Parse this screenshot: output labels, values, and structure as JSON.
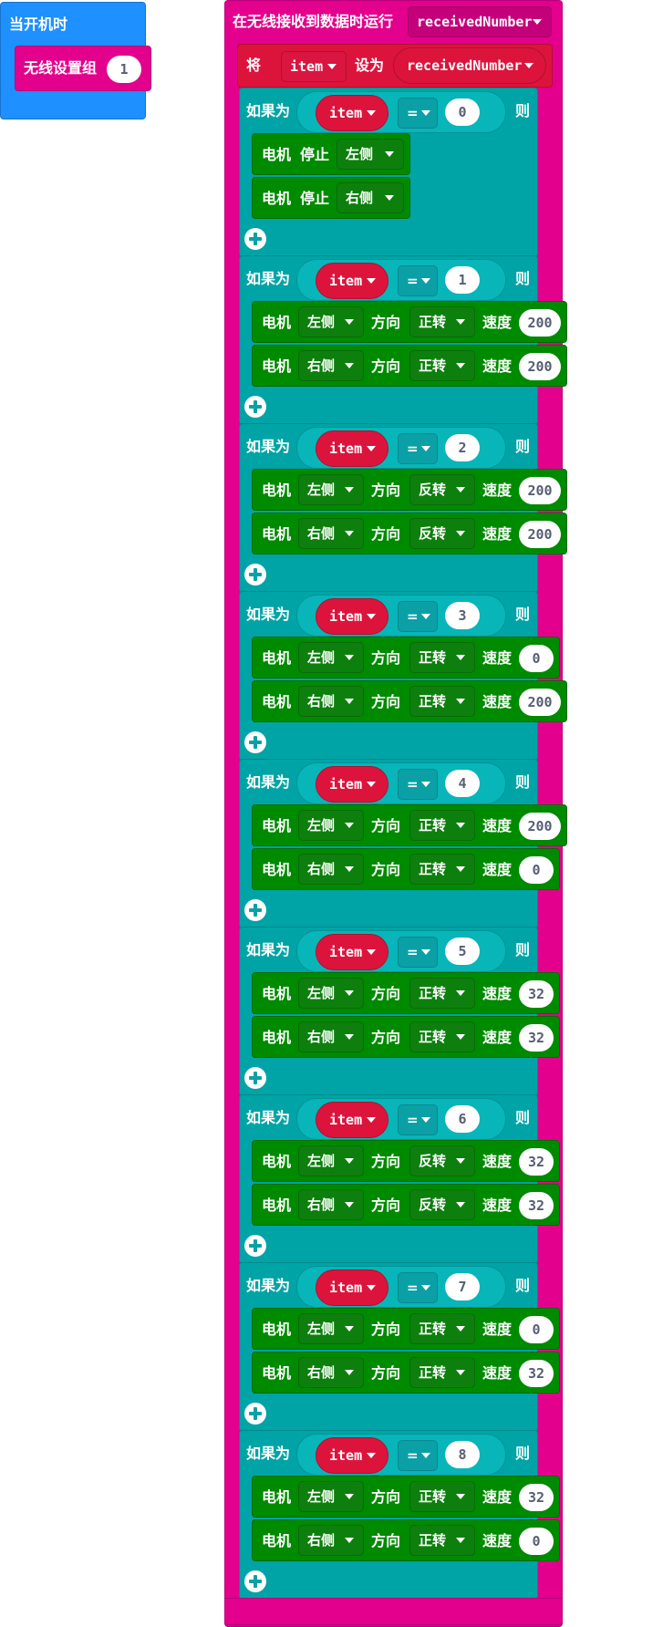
{
  "on_start": {
    "label": "当开机时",
    "radio_set_group": {
      "label": "无线设置组",
      "value": "1"
    }
  },
  "on_received": {
    "label": "在无线接收到数据时运行",
    "param": "receivedNumber",
    "set_block": {
      "label_set": "将",
      "var": "item",
      "label_to": "设为",
      "value": "receivedNumber"
    }
  },
  "if_labels": {
    "if": "如果为",
    "then": "则",
    "op": "="
  },
  "motor_labels": {
    "motor": "电机",
    "dir": "方向",
    "speed": "速度",
    "stop": "停止"
  },
  "conditions": [
    {
      "var": "item",
      "value": "0",
      "actions": [
        {
          "type": "stop",
          "side": "左侧"
        },
        {
          "type": "stop",
          "side": "右侧"
        }
      ]
    },
    {
      "var": "item",
      "value": "1",
      "actions": [
        {
          "type": "run",
          "side": "左侧",
          "direction": "正转",
          "speed": "200"
        },
        {
          "type": "run",
          "side": "右侧",
          "direction": "正转",
          "speed": "200"
        }
      ]
    },
    {
      "var": "item",
      "value": "2",
      "actions": [
        {
          "type": "run",
          "side": "左侧",
          "direction": "反转",
          "speed": "200"
        },
        {
          "type": "run",
          "side": "右侧",
          "direction": "反转",
          "speed": "200"
        }
      ]
    },
    {
      "var": "item",
      "value": "3",
      "actions": [
        {
          "type": "run",
          "side": "左侧",
          "direction": "正转",
          "speed": "0"
        },
        {
          "type": "run",
          "side": "右侧",
          "direction": "正转",
          "speed": "200"
        }
      ]
    },
    {
      "var": "item",
      "value": "4",
      "actions": [
        {
          "type": "run",
          "side": "左侧",
          "direction": "正转",
          "speed": "200"
        },
        {
          "type": "run",
          "side": "右侧",
          "direction": "正转",
          "speed": "0"
        }
      ]
    },
    {
      "var": "item",
      "value": "5",
      "actions": [
        {
          "type": "run",
          "side": "左侧",
          "direction": "正转",
          "speed": "32"
        },
        {
          "type": "run",
          "side": "右侧",
          "direction": "正转",
          "speed": "32"
        }
      ]
    },
    {
      "var": "item",
      "value": "6",
      "actions": [
        {
          "type": "run",
          "side": "左侧",
          "direction": "反转",
          "speed": "32"
        },
        {
          "type": "run",
          "side": "右侧",
          "direction": "反转",
          "speed": "32"
        }
      ]
    },
    {
      "var": "item",
      "value": "7",
      "actions": [
        {
          "type": "run",
          "side": "左侧",
          "direction": "正转",
          "speed": "0"
        },
        {
          "type": "run",
          "side": "右侧",
          "direction": "正转",
          "speed": "32"
        }
      ]
    },
    {
      "var": "item",
      "value": "8",
      "actions": [
        {
          "type": "run",
          "side": "左侧",
          "direction": "正转",
          "speed": "32"
        },
        {
          "type": "run",
          "side": "右侧",
          "direction": "正转",
          "speed": "0"
        }
      ]
    }
  ],
  "colors": {
    "start_block": "#1e90ff",
    "radio_block": "#e3008c",
    "variable_block": "#dc143c",
    "logic_block": "#00a4a6",
    "motor_block": "#008a00"
  }
}
